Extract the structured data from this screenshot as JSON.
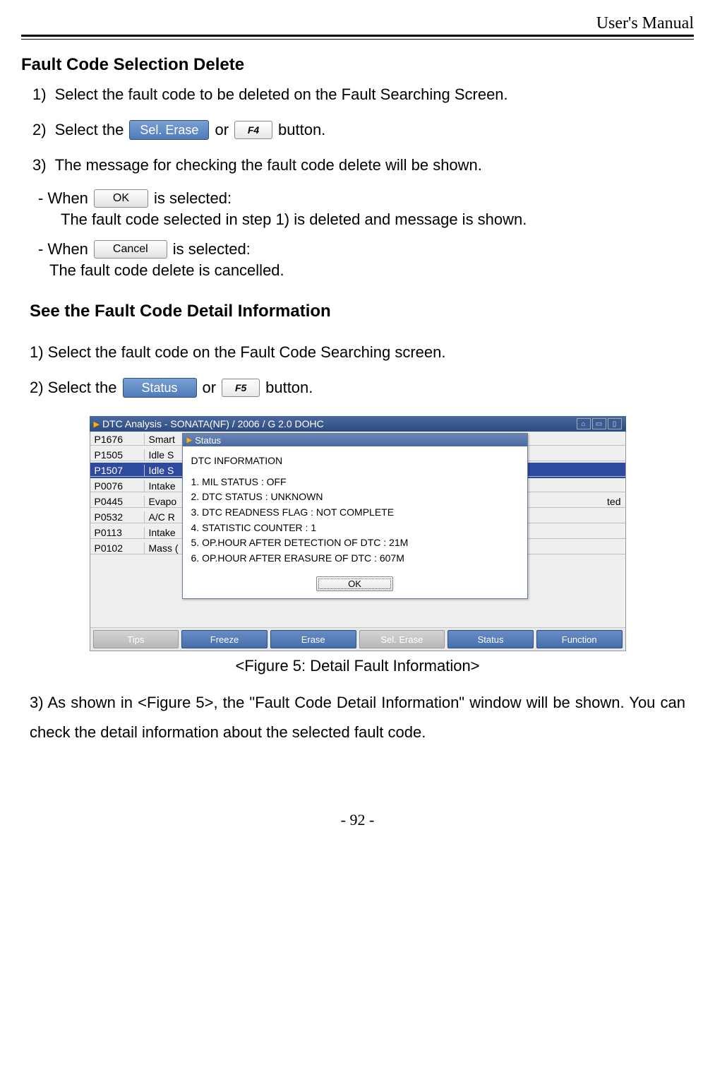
{
  "header": {
    "right": "User's Manual"
  },
  "s1": {
    "heading": "Fault Code Selection Delete",
    "step1_num": "1)",
    "step1": "Select the fault code to be deleted on the Fault Searching Screen.",
    "step2_num": "2)",
    "step2a": "Select the",
    "step2_btn": "Sel. Erase",
    "step2_or": "or",
    "step2_fkey": "F4",
    "step2b": "button.",
    "step3_num": "3)",
    "step3": "The message for checking the fault code delete will be shown.",
    "when1a": "- When",
    "ok_btn": "OK",
    "when1b": "is selected:",
    "when1_text": "The fault code selected in step 1) is deleted and message is shown.",
    "when2a": "- When",
    "cancel_btn": "Cancel",
    "when2b": "is selected:",
    "when2_text": "The fault code delete is cancelled."
  },
  "s2": {
    "heading": "See the Fault Code Detail Information",
    "step1": "1) Select the fault code on the Fault Code Searching screen.",
    "step2a": "2) Select the",
    "step2_btn": "Status",
    "step2_or": "or",
    "step2_fkey": "F5",
    "step2b": "button."
  },
  "screenshot": {
    "title": "DTC Analysis - SONATA(NF) / 2006 / G 2.0 DOHC",
    "rows": [
      {
        "code": "P1676",
        "desc": "Smart",
        "sel": false
      },
      {
        "code": "P1505",
        "desc": "Idle S",
        "sel": false
      },
      {
        "code": "P1507",
        "desc": "Idle S",
        "sel": true
      },
      {
        "code": "P0076",
        "desc": "Intake",
        "sel": false
      },
      {
        "code": "P0445",
        "desc": "Evapo",
        "sel": false,
        "tail": "ted"
      },
      {
        "code": "P0532",
        "desc": "A/C R",
        "sel": false
      },
      {
        "code": "P0113",
        "desc": "Intake",
        "sel": false
      },
      {
        "code": "P0102",
        "desc": "Mass (",
        "sel": false
      }
    ],
    "popup_title": "Status",
    "popup_heading": "DTC INFORMATION",
    "popup_lines": [
      "1. MIL STATUS : OFF",
      "2. DTC STATUS : UNKNOWN",
      "3. DTC READNESS FLAG : NOT COMPLETE",
      "4. STATISTIC COUNTER : 1",
      "5. OP.HOUR AFTER DETECTION OF DTC : 21M",
      "6. OP.HOUR AFTER ERASURE OF DTC : 607M"
    ],
    "popup_ok": "OK",
    "toolbar": [
      "Tips",
      "Freeze",
      "Erase",
      "Sel. Erase",
      "Status",
      "Function"
    ]
  },
  "fig_caption": "<Figure 5: Detail Fault Information>",
  "para3": "3) As shown in <Figure 5>, the \"Fault Code Detail Information\" window will be shown. You can check the detail information about the selected fault code.",
  "page_num": "- 92 -"
}
